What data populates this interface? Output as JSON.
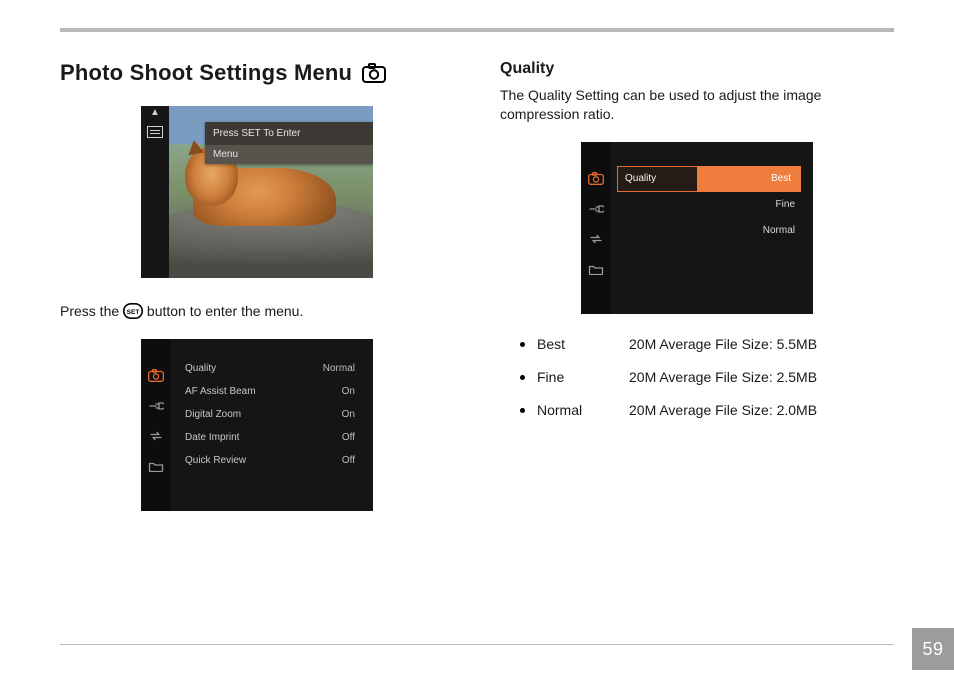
{
  "page_number": "59",
  "left": {
    "heading": "Photo Shoot Settings Menu",
    "tooltip_line1": "Press SET To Enter",
    "tooltip_line2": "Menu",
    "press_line_before": "Press the ",
    "press_line_after": " button to enter the menu.",
    "settings_menu": {
      "sidebar_icons": [
        "camera-icon",
        "plug-icon",
        "loop-icon",
        "folder-icon"
      ],
      "rows": [
        {
          "label": "Quality",
          "value": "Normal"
        },
        {
          "label": "AF Assist Beam",
          "value": "On"
        },
        {
          "label": "Digital Zoom",
          "value": "On"
        },
        {
          "label": "Date Imprint",
          "value": "Off"
        },
        {
          "label": "Quick Review",
          "value": "Off"
        }
      ]
    }
  },
  "right": {
    "heading": "Quality",
    "description": "The Quality Setting can be used to adjust the image compression ratio.",
    "quality_menu": {
      "sidebar_icons": [
        "camera-icon",
        "plug-icon",
        "loop-icon",
        "folder-icon"
      ],
      "label": "Quality",
      "options": [
        "Best",
        "Fine",
        "Normal"
      ],
      "selected": "Best"
    },
    "quality_list": [
      {
        "name": "Best",
        "size": "20M Average File Size: 5.5MB"
      },
      {
        "name": "Fine",
        "size": "20M Average File Size: 2.5MB"
      },
      {
        "name": "Normal",
        "size": "20M Average File Size: 2.0MB"
      }
    ]
  },
  "icons": {
    "camera_title": "camera-icon",
    "set_button": "set-button-icon"
  }
}
